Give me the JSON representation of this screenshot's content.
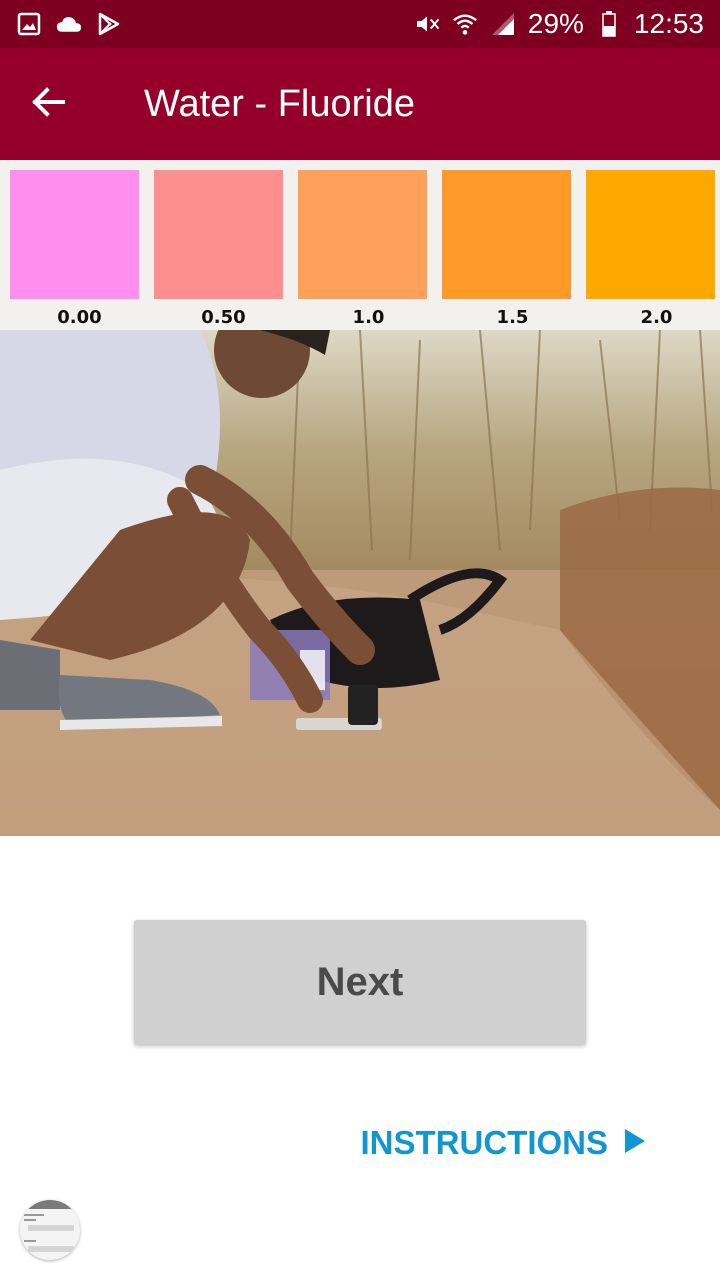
{
  "status_bar": {
    "left_icons": [
      "image-icon",
      "cloud-icon",
      "play-store-icon"
    ],
    "right_icons": [
      "mute-icon",
      "wifi-icon",
      "signal-icon"
    ],
    "battery": "29%",
    "time": "12:53"
  },
  "app_bar": {
    "title": "Water - Fluoride",
    "back_icon": "arrow-left-icon"
  },
  "color_chart": {
    "swatches": [
      {
        "label": "0.00",
        "color": "#ff8eee"
      },
      {
        "label": "0.50",
        "color": "#ff8f8f"
      },
      {
        "label": "1.0",
        "color": "#ffa05a"
      },
      {
        "label": "1.5",
        "color": "#ff9a2a"
      },
      {
        "label": "2.0",
        "color": "#ffa900"
      }
    ]
  },
  "actions": {
    "next_label": "Next",
    "instructions_label": "INSTRUCTIONS"
  },
  "colors": {
    "status_bar": "#7e0020",
    "app_bar": "#95002a",
    "link": "#1296d2",
    "button_bg": "#d0d0d0"
  }
}
